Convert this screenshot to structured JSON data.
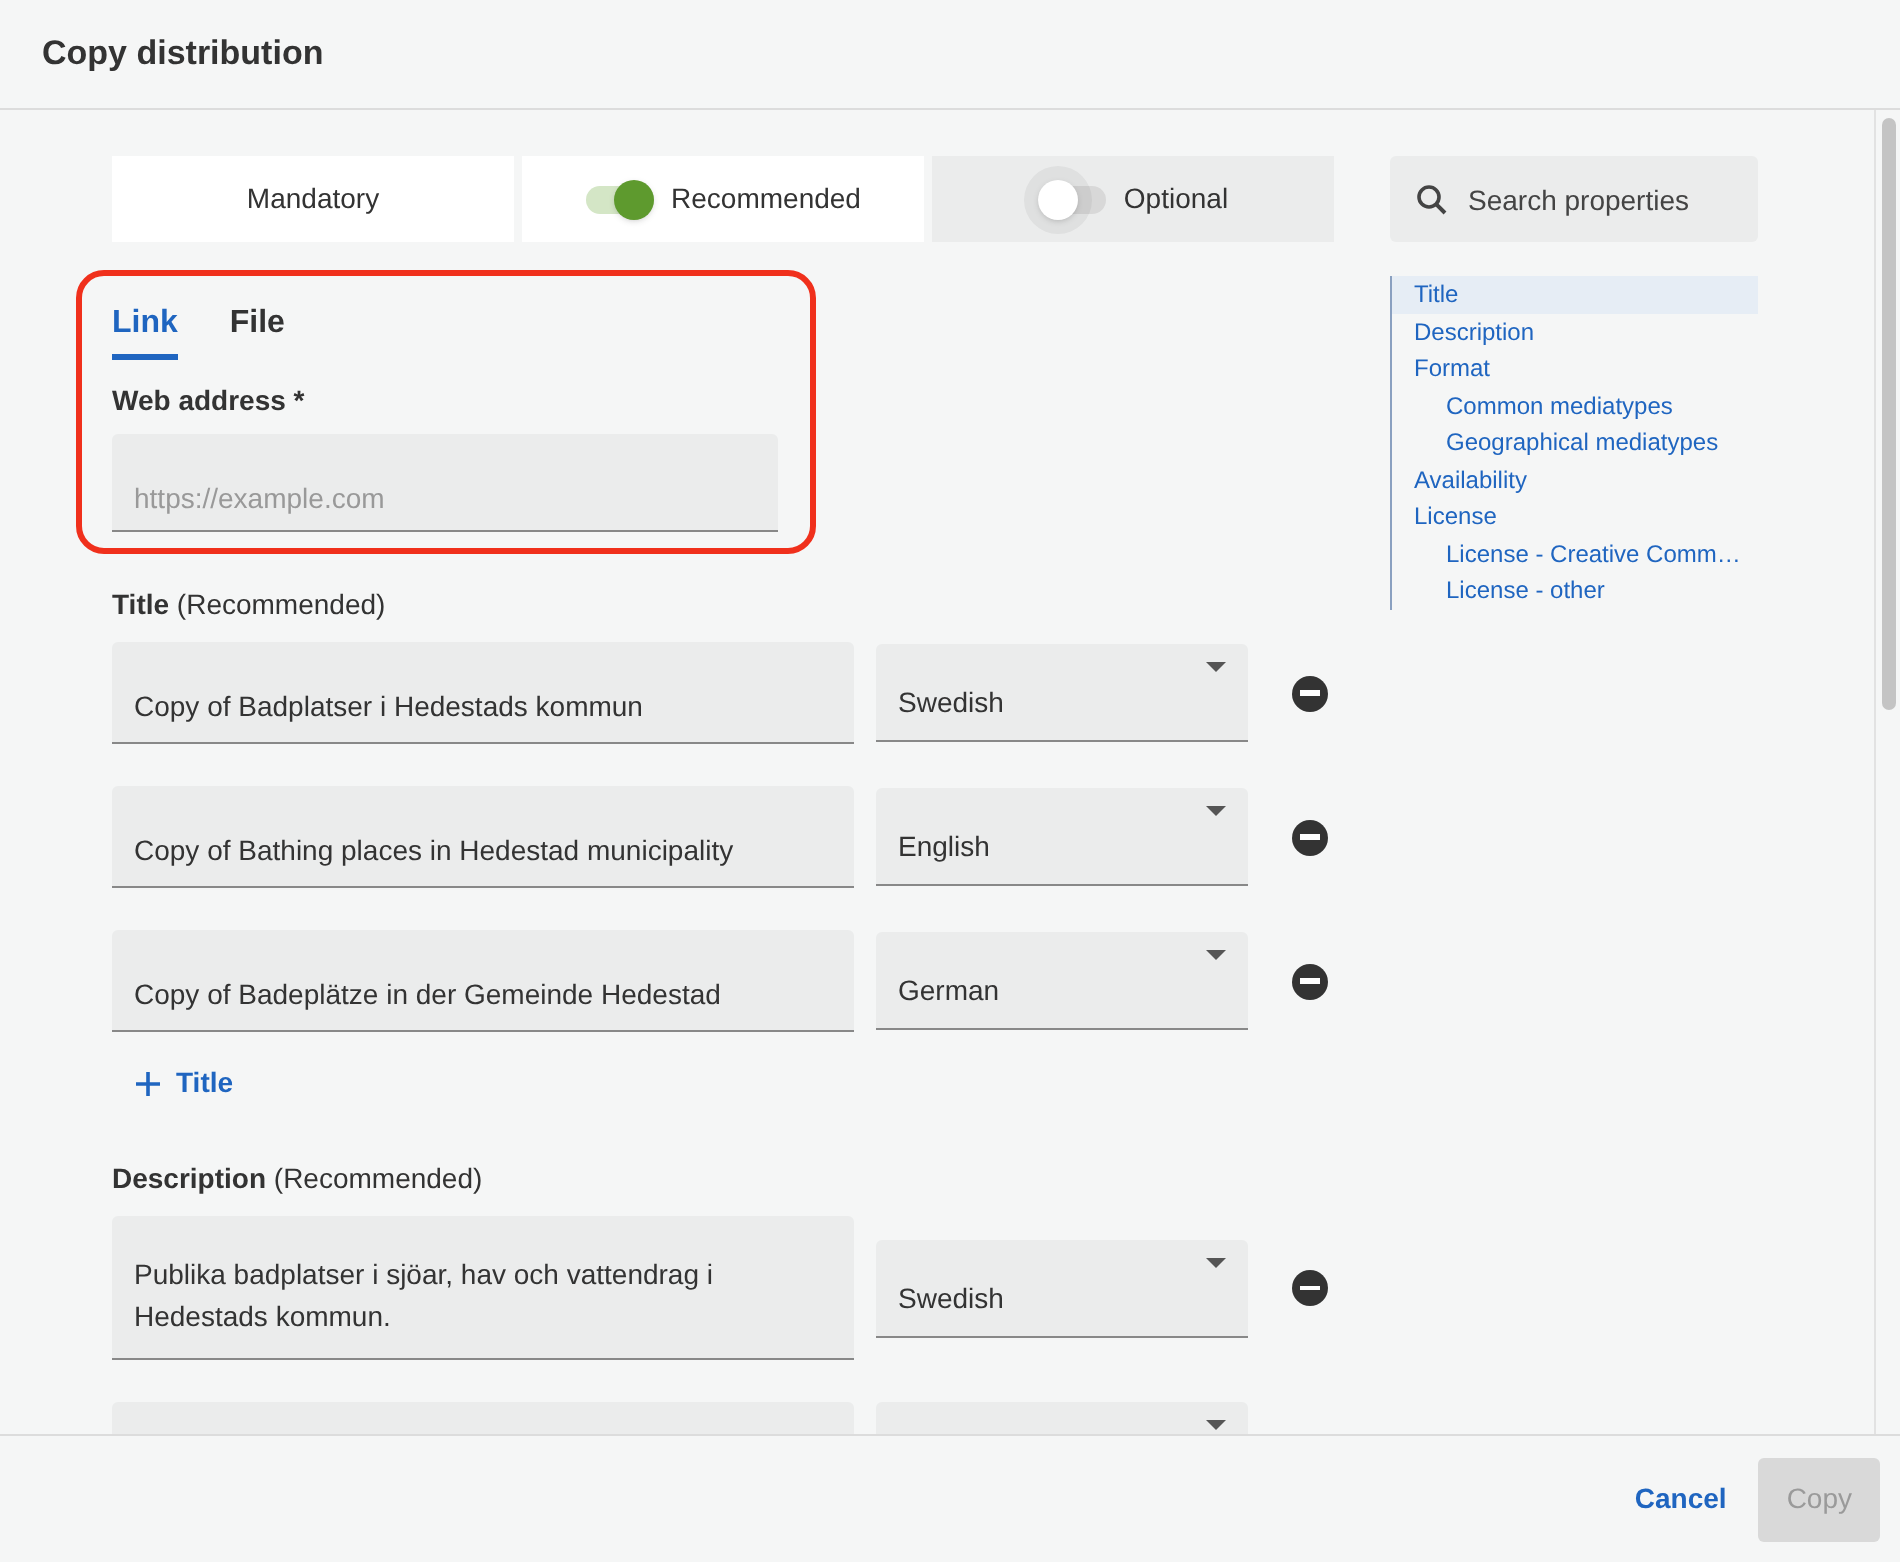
{
  "dialog": {
    "title": "Copy distribution"
  },
  "filters": [
    {
      "label": "Mandatory",
      "kind": "plain"
    },
    {
      "label": "Recommended",
      "kind": "toggle",
      "on": true
    },
    {
      "label": "Optional",
      "kind": "toggle",
      "on": false
    }
  ],
  "source_tabs": [
    {
      "label": "Link",
      "selected": true
    },
    {
      "label": "File",
      "selected": false
    }
  ],
  "web_address": {
    "label": "Web address *",
    "placeholder": "https://example.com",
    "highlighted": true
  },
  "sections": [
    {
      "label": "Title",
      "note": "(Recommended)",
      "rows": [
        {
          "value": "Copy of Badplatser i Hedestads kommun",
          "language": "Swedish"
        },
        {
          "value": "Copy of Bathing places in Hedestad municipality",
          "language": "English"
        },
        {
          "value": "Copy of Badeplätze in der Gemeinde Hedestad",
          "language": "German"
        }
      ],
      "add_label": "Title"
    },
    {
      "label": "Description",
      "note": "(Recommended)",
      "rows": [
        {
          "value": "Publika badplatser i sjöar, hav och vattendrag i Hedestads kommun.",
          "language": "Swedish"
        },
        {}
      ]
    }
  ],
  "search": {
    "placeholder": "Search properties"
  },
  "nav": [
    {
      "label": "Title",
      "selected": true
    },
    {
      "label": "Description",
      "selected": false
    },
    {
      "label": "Format",
      "selected": false,
      "children": [
        {
          "label": "Common mediatypes",
          "selected": false
        },
        {
          "label": "Geographical mediatypes",
          "selected": false
        }
      ]
    },
    {
      "label": "Availability",
      "selected": false
    },
    {
      "label": "License",
      "selected": false,
      "children": [
        {
          "label": "License - Creative Comm…",
          "selected": false
        },
        {
          "label": "License - other",
          "selected": false
        }
      ]
    }
  ],
  "footer": {
    "cancel": "Cancel",
    "confirm": "Copy",
    "confirm_disabled": true
  }
}
